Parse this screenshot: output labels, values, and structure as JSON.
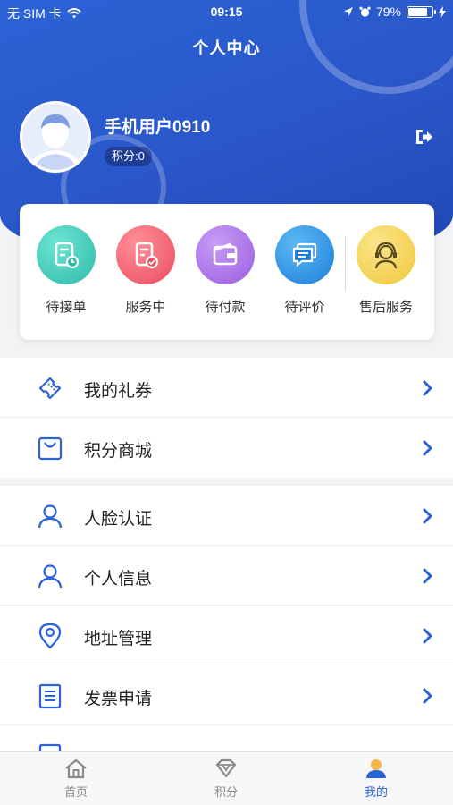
{
  "status_bar": {
    "carrier": "无 SIM 卡",
    "time": "09:15",
    "battery": "79%"
  },
  "header": {
    "title": "个人中心"
  },
  "user": {
    "name": "手机用户0910",
    "points_label": "积分:0"
  },
  "orders": [
    {
      "label": "待接单",
      "icon": "clipboard-clock-icon",
      "color": "#3cc9b8"
    },
    {
      "label": "服务中",
      "icon": "document-check-icon",
      "color": "#f05b6b"
    },
    {
      "label": "待付款",
      "icon": "wallet-icon",
      "color": "#a66de6"
    },
    {
      "label": "待评价",
      "icon": "comment-icon",
      "color": "#2a8fe6"
    },
    {
      "label": "售后服务",
      "icon": "headset-agent-icon",
      "color": "#f4d24f"
    }
  ],
  "menu_group_1": [
    {
      "label": "我的礼券",
      "icon": "ticket-icon"
    },
    {
      "label": "积分商城",
      "icon": "shopping-bag-icon"
    }
  ],
  "menu_group_2": [
    {
      "label": "人脸认证",
      "icon": "user-icon"
    },
    {
      "label": "个人信息",
      "icon": "user-icon"
    },
    {
      "label": "地址管理",
      "icon": "location-pin-icon"
    },
    {
      "label": "发票申请",
      "icon": "invoice-icon"
    }
  ],
  "tabbar": [
    {
      "label": "首页",
      "icon": "home-icon",
      "active": false
    },
    {
      "label": "积分",
      "icon": "diamond-icon",
      "active": false
    },
    {
      "label": "我的",
      "icon": "profile-icon",
      "active": true
    }
  ]
}
